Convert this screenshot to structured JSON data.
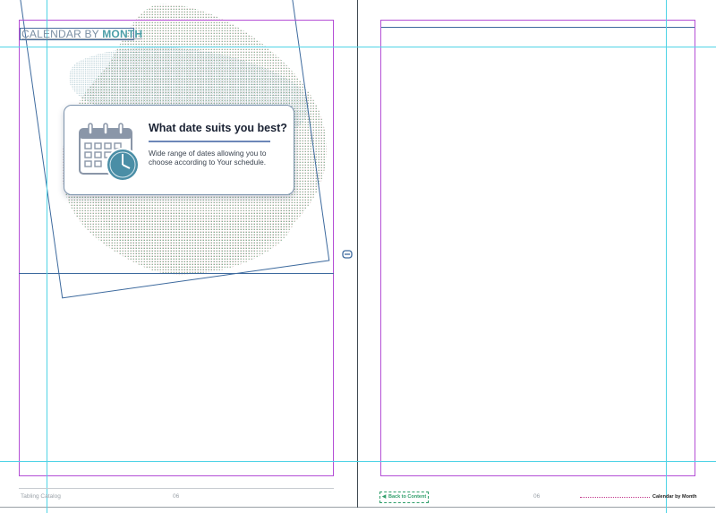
{
  "header": {
    "prefix": "CALENDAR BY ",
    "accent": "MONTH"
  },
  "card": {
    "title": "What date suits you best?",
    "description": "Wide range of dates allowing you to choose according to Your schedule.",
    "icon": "calendar-clock-icon"
  },
  "footer": {
    "left_text": "Tabling Catalog",
    "left_page": "06",
    "right_page": "06",
    "back_button": "Back to Content",
    "right_text": "Calendar by Month"
  },
  "colors": {
    "margin_guide": "#b44fd6",
    "column_guide": "#4fd3e6",
    "frame": "#3d6a9e",
    "accent": "#4d9fa8"
  }
}
